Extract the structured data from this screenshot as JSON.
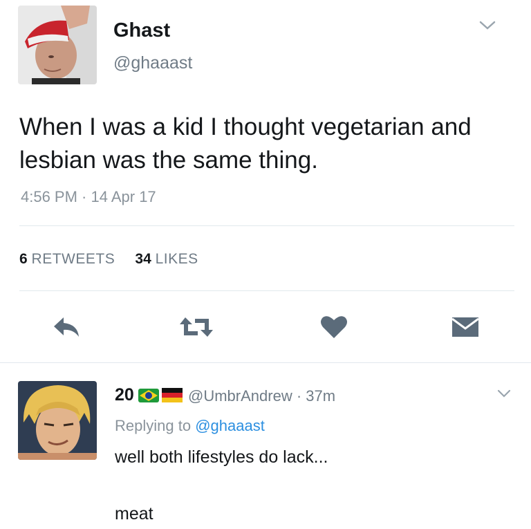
{
  "tweet": {
    "display_name": "Ghast",
    "handle": "@ghaaast",
    "text_line1": "When I was a kid I thought vegetarian and",
    "text_line2": "lesbian was the same thing.",
    "timestamp": "4:56 PM · 14 Apr 17",
    "retweets_count": "6",
    "retweets_label": "RETWEETS",
    "likes_count": "34",
    "likes_label": "LIKES"
  },
  "actions": [
    "reply-icon",
    "retweet-icon",
    "heart-icon",
    "message-icon"
  ],
  "reply": {
    "display_name": "20",
    "handle_time": "@UmbrAndrew · 37m",
    "replying_prefix": "Replying to",
    "replying_mention": "@ghaaast",
    "text_line1": "well both lifestyles do lack...",
    "text_line2": "meat"
  },
  "colors": {
    "text": "#14171a",
    "secondary": "#6f7b86",
    "link": "#2c8fe0",
    "icon": "#5b6b7a",
    "divider": "#e1e8ed"
  }
}
